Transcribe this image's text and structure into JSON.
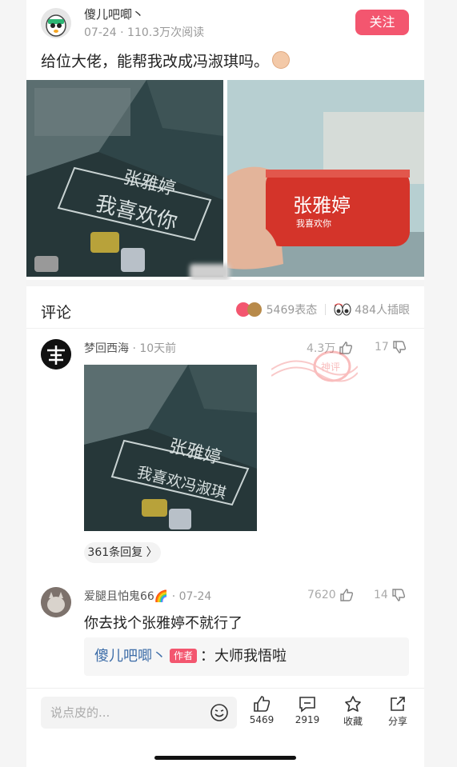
{
  "post": {
    "author": "傻儿吧唧丶",
    "date": "07-24",
    "reads": "110.3万次阅读",
    "follow_label": "关注",
    "text": "给位大佬，能帮我改成冯淑琪吗。",
    "image1_text": [
      "张雅婷",
      "我喜欢你"
    ],
    "image2_text": [
      "张雅婷",
      "我喜欢你"
    ]
  },
  "comments_header": {
    "title": "评论",
    "reactions": "5469表态",
    "inserts": "484人插眼"
  },
  "comments": [
    {
      "user": "梦回西海",
      "time": "10天前",
      "likes": "4.3万",
      "dislikes": "17",
      "image_text": [
        "张雅婷",
        "我喜欢冯淑琪"
      ],
      "replies": "361条回复 〉"
    },
    {
      "user": "爱腿且怕鬼66🌈",
      "time": "07-24",
      "likes": "7620",
      "dislikes": "14",
      "text": "你去找个张雅婷不就行了",
      "reply": {
        "author": "傻儿吧唧丶",
        "badge": "作者",
        "colon": "：",
        "text": "大师我悟啦"
      }
    }
  ],
  "bottom": {
    "placeholder": "说点皮的...",
    "like_count": "5469",
    "comment_count": "2919",
    "fav_label": "收藏",
    "share_label": "分享"
  },
  "stamp_text": "神评",
  "colors": {
    "accent": "#f3566f",
    "link": "#3d6da8"
  }
}
